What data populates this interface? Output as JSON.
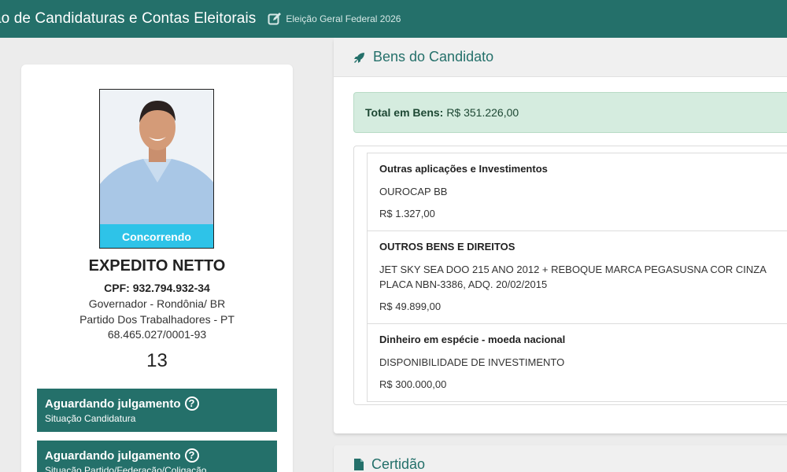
{
  "header": {
    "title": "ão de Candidaturas e Contas Eleitorais",
    "election": "Eleição Geral Federal 2026",
    "edit_icon": "edit-icon"
  },
  "candidate": {
    "status_badge": "Concorrendo",
    "name": "EXPEDITO NETTO",
    "cpf": "CPF: 932.794.932-34",
    "office": "Governador - Rondônia/ BR",
    "party": "Partido Dos Trabalhadores - PT",
    "cnpj": "68.465.027/0001-93",
    "number": "13"
  },
  "status_boxes": [
    {
      "title": "Aguardando julgamento",
      "subtitle": "Situação Candidatura"
    },
    {
      "title": "Aguardando julgamento",
      "subtitle": "Situação Partido/Federação/Coligação"
    }
  ],
  "assets": {
    "header": "Bens do Candidato",
    "total_label": "Total em Bens:",
    "total_value": "R$ 351.226,00",
    "items": [
      {
        "type": "Outras aplicações e Investimentos",
        "description": "OUROCAP BB",
        "value": "R$ 1.327,00"
      },
      {
        "type": "OUTROS BENS E DIREITOS",
        "description": "JET SKY SEA DOO 215 ANO 2012 + REBOQUE MARCA PEGASUSNA COR CINZA PLACA NBN-3386, ADQ. 20/02/2015",
        "value": "R$ 49.899,00"
      },
      {
        "type": "Dinheiro em espécie - moeda nacional",
        "description": "DISPONIBILIDADE DE INVESTIMENTO",
        "value": "R$ 300.000,00"
      }
    ]
  },
  "certificate": {
    "header": "Certidão"
  },
  "colors": {
    "brand": "#24706a",
    "badge": "#2ec3e8",
    "total_bg": "#d5ecdf"
  }
}
